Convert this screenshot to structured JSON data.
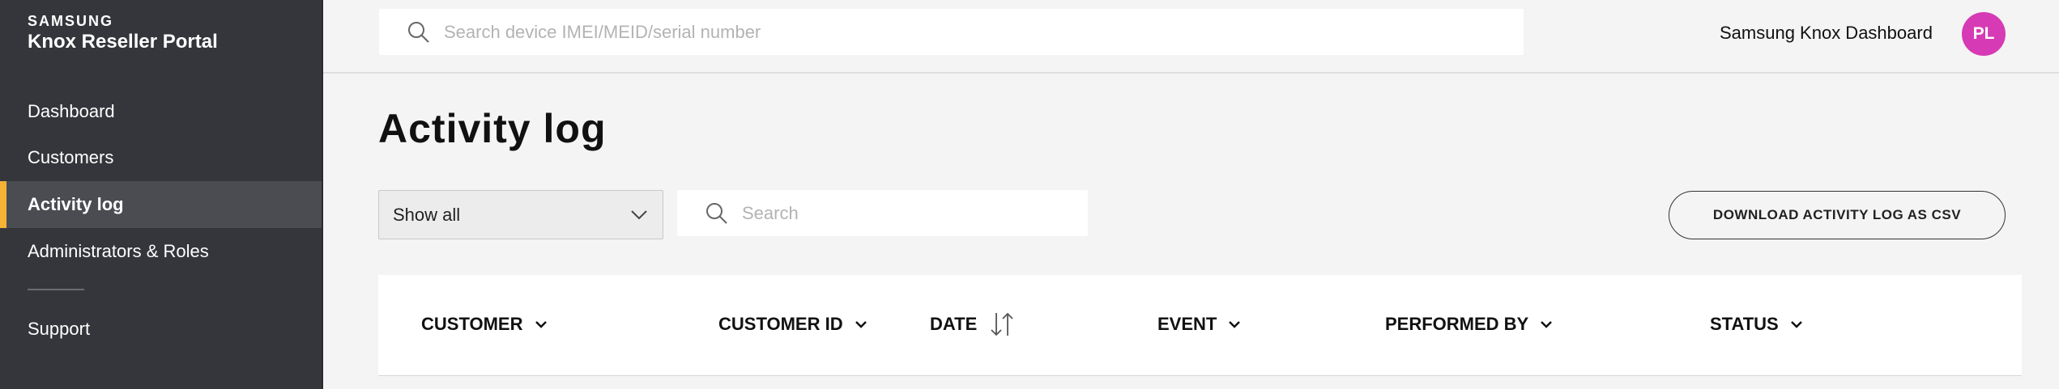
{
  "brand": {
    "wordmark": "SAMSUNG",
    "product": "Knox Reseller Portal"
  },
  "sidebar": {
    "items": [
      {
        "label": "Dashboard"
      },
      {
        "label": "Customers"
      },
      {
        "label": "Activity log",
        "active": true
      },
      {
        "label": "Administrators & Roles"
      },
      {
        "label": "Support"
      }
    ]
  },
  "topbar": {
    "search_placeholder": "Search device IMEI/MEID/serial number",
    "dashboard_title": "Samsung Knox Dashboard",
    "avatar_initials": "PL"
  },
  "main": {
    "title": "Activity log",
    "filter": {
      "selected": "Show all"
    },
    "search_placeholder": "Search",
    "download_label": "DOWNLOAD ACTIVITY LOG AS CSV"
  },
  "table": {
    "columns": [
      {
        "label": "CUSTOMER",
        "icon": "chevron-down-icon"
      },
      {
        "label": "CUSTOMER ID",
        "icon": "chevron-down-icon"
      },
      {
        "label": "DATE",
        "icon": "sort-icon"
      },
      {
        "label": "EVENT",
        "icon": "chevron-down-icon"
      },
      {
        "label": "PERFORMED BY",
        "icon": "chevron-down-icon"
      },
      {
        "label": "STATUS",
        "icon": "chevron-down-icon"
      }
    ]
  },
  "colors": {
    "sidebar_bg": "#34363b",
    "active_accent": "#f5b335",
    "avatar_bg": "#d63ab4",
    "page_bg": "#f4f4f4"
  }
}
